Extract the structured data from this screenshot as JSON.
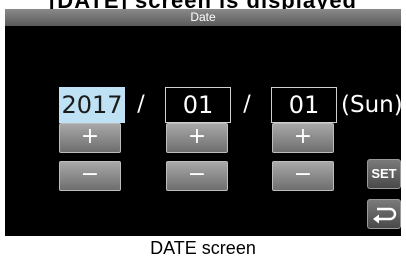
{
  "page": {
    "top_fragment": "[DATE] screen is displayed",
    "caption": "DATE screen"
  },
  "screen": {
    "title": "Date",
    "date": {
      "year": "2017",
      "month": "01",
      "day": "01",
      "separator": "/",
      "weekday": "(Sun)",
      "selected_field": "year"
    },
    "buttons": {
      "increment_label": "+",
      "decrement_label": "−",
      "set_label": "SET",
      "back_icon": "return-arrow-icon"
    }
  },
  "colors": {
    "screen_bg": "#000000",
    "selected_field_bg": "#bfe1f4",
    "button_gray": "#8c8c8c",
    "title_bar": "#707070"
  }
}
